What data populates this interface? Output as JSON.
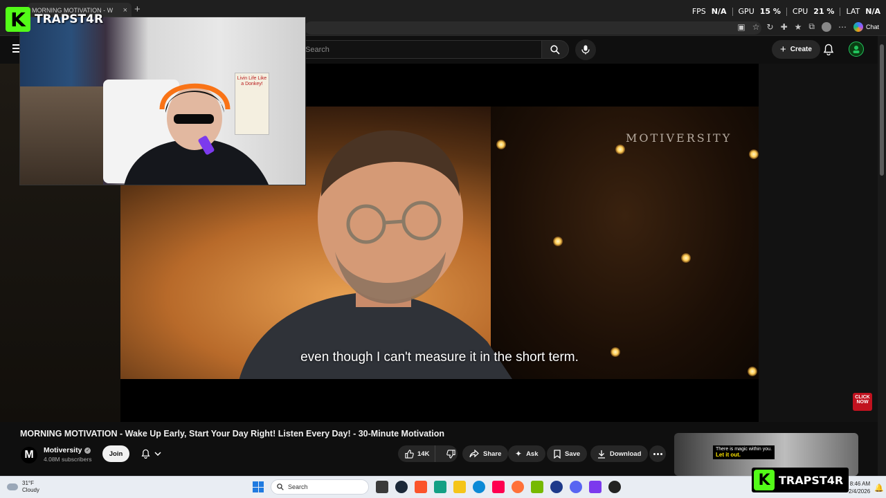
{
  "browser": {
    "tab_title": "MORNING MOTIVATION - W",
    "tab_close": "×",
    "new_tab": "+",
    "chat_label": "Chat"
  },
  "perf_overlay": {
    "fps_label": "FPS",
    "fps_value": "N/A",
    "gpu_label": "GPU",
    "gpu_value": "15 %",
    "cpu_label": "CPU",
    "cpu_value": "21 %",
    "lat_label": "LAT",
    "lat_value": "N/A"
  },
  "youtube": {
    "search_placeholder": "Search",
    "create_label": "Create"
  },
  "video": {
    "subtitle": "even though I can't measure it in the short term.",
    "brand_text": "MOTIVERSITY",
    "click_now": "CLICK NOW"
  },
  "stream_overlay": {
    "channel_name": "TRAPST4R",
    "logo_letter": "K",
    "poster_text": "Livin Life Like a Donkey!"
  },
  "video_info": {
    "title": "MORNING MOTIVATION - Wake Up Early, Start Your Day Right! Listen Every Day! - 30-Minute Motivation",
    "channel": "Motiversity",
    "channel_initial": "M",
    "subscribers": "4.08M subscribers",
    "join_label": "Join",
    "like_count": "14K",
    "share_label": "Share",
    "ask_label": "Ask",
    "save_label": "Save",
    "download_label": "Download"
  },
  "related": {
    "caption_top": "There is magic within you.",
    "caption_main": "Let it out."
  },
  "taskbar": {
    "temperature": "31°F",
    "condition": "Cloudy",
    "search_label": "Search",
    "time": "8:46 AM",
    "date": "2/4/2026"
  },
  "colors": {
    "kick_green": "#53fc18",
    "youtube_bg": "#0f0f0f",
    "taskbar_bg": "#e9edf3"
  }
}
